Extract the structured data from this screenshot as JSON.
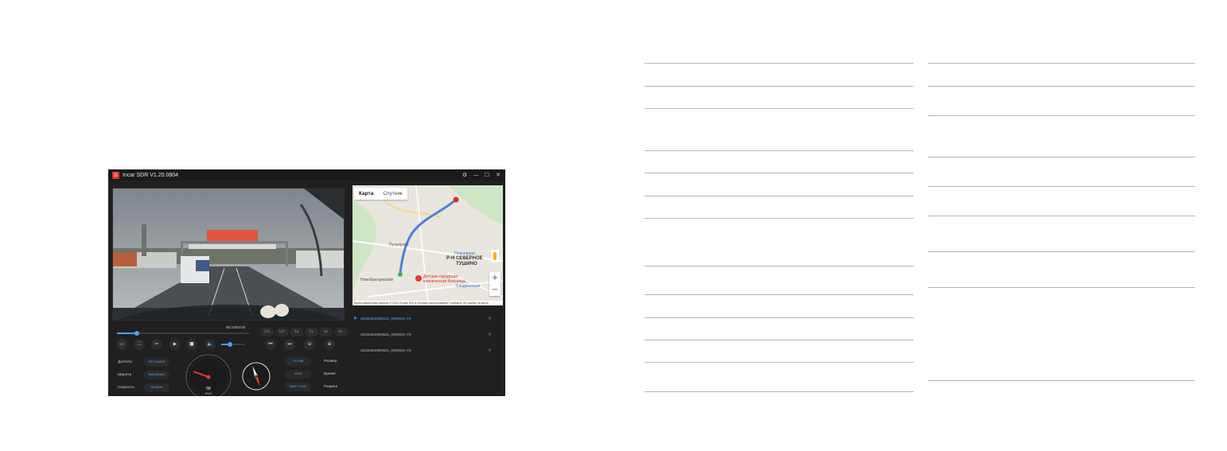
{
  "app": {
    "title": "Incar SDR V1.20.0804",
    "logo_letter": "D",
    "window_controls": {
      "settings": "⚙",
      "minimize": "—",
      "maximize": "☐",
      "close": "✕"
    }
  },
  "map": {
    "tabs": [
      {
        "label": "Карта",
        "active": true
      },
      {
        "label": "Спутник",
        "active": false
      }
    ],
    "labels": {
      "place1": "Путилково",
      "place2": "Новобратцевский",
      "district_line1": "Р-Н СЕВЕРНОЕ",
      "district_line2": "ТУШИНО",
      "poi1": "Планерная",
      "poi2": "Сходненская",
      "hospital_line1": "Детская городская",
      "hospital_line2": "клиническая больница..."
    },
    "zoom_in": "+",
    "zoom_out": "−",
    "footer": "Картографические данные © 2024 Google   500 м   Условия использования   Сообщить об ошибке на карте"
  },
  "playlist": [
    {
      "name": "20230302083121_000002A.TS",
      "active": true
    },
    {
      "name": "20230302083621_000003A.TS",
      "active": false
    },
    {
      "name": "20230302083921_000004A.TS",
      "active": false
    }
  ],
  "playlist_play_icon": "▶",
  "playlist_close_icon": "✕",
  "player": {
    "time": "00:23/03:00",
    "progress_fraction": 0.15,
    "volume_fraction": 0.35,
    "speeds": [
      {
        "label": "1/4",
        "active": false
      },
      {
        "label": "1/2",
        "active": false
      },
      {
        "label": "1x",
        "active": true
      },
      {
        "label": "2x",
        "active": false
      },
      {
        "label": "4x",
        "active": false
      },
      {
        "label": "8x",
        "active": false
      }
    ],
    "controls": {
      "open": "▭",
      "fullscreen": "⛶",
      "cut": "✂",
      "play": "▶",
      "stop": "■",
      "volume": "🔈",
      "prev": "⏮",
      "next": "⏭",
      "zoom_out": "⊖",
      "zoom_in": "⊕"
    }
  },
  "info": {
    "longitude": {
      "label": "Долгота",
      "value": "E37.394226"
    },
    "latitude": {
      "label": "Широта",
      "value": "N55.890661"
    },
    "speed": {
      "label": "Скорость",
      "value": "58 KM/H"
    },
    "size": {
      "label": "Размер",
      "value": "79.4 MB"
    },
    "time": {
      "label": "Время",
      "value": "03:00"
    },
    "resolution": {
      "label": "Разреш",
      "value": "3840 * 2160"
    }
  },
  "speedometer": {
    "value": 58,
    "max": 240,
    "unit": "KM/H"
  },
  "compass": {
    "heading_deg": 160
  },
  "accent_color": "#4a9eff",
  "route_color": "#4f7ddb"
}
